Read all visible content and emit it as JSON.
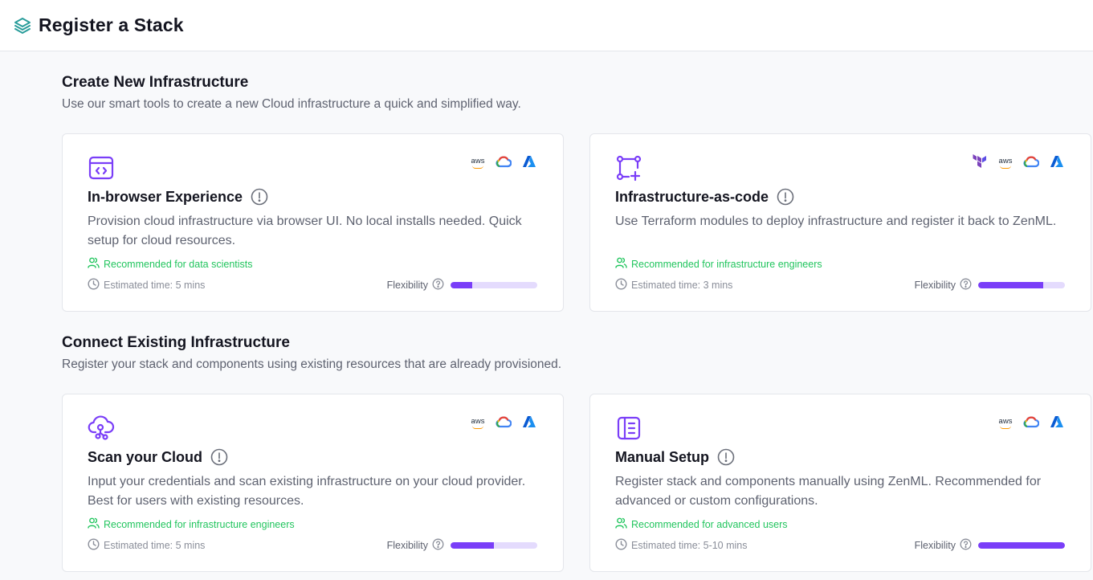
{
  "header": {
    "title": "Register a Stack",
    "icon": "stack-layers-icon"
  },
  "sections": [
    {
      "title": "Create New Infrastructure",
      "subtitle": "Use our smart tools to create a new Cloud infrastructure a quick and simplified way."
    },
    {
      "title": "Connect Existing Infrastructure",
      "subtitle": "Register your stack and components using existing resources that are already provisioned."
    }
  ],
  "cards": [
    {
      "title": "In-browser Experience",
      "icon": "browser-code-icon",
      "providers": [
        "aws",
        "gcp",
        "azure"
      ],
      "description": "Provision cloud infrastructure via browser UI. No local installs needed. Quick setup for cloud resources.",
      "recommended": "Recommended for data scientists",
      "estimated": "Estimated time: 5 mins",
      "flexibility_label": "Flexibility",
      "flexibility": 0.25
    },
    {
      "title": "Infrastructure-as-code",
      "icon": "nodes-plus-icon",
      "providers": [
        "terraform",
        "aws",
        "gcp",
        "azure"
      ],
      "description": "Use Terraform modules to deploy infrastructure and register it back to ZenML.",
      "recommended": "Recommended for infrastructure engineers",
      "estimated": "Estimated time: 3 mins",
      "flexibility_label": "Flexibility",
      "flexibility": 0.75
    },
    {
      "title": "Scan your Cloud",
      "icon": "cloud-scan-icon",
      "providers": [
        "aws",
        "gcp",
        "azure"
      ],
      "description": "Input your credentials and scan existing infrastructure on your cloud provider. Best for users with existing resources.",
      "recommended": "Recommended for infrastructure engineers",
      "estimated": "Estimated time: 5 mins",
      "flexibility_label": "Flexibility",
      "flexibility": 0.5
    },
    {
      "title": "Manual Setup",
      "icon": "manual-list-icon",
      "providers": [
        "aws",
        "gcp",
        "azure"
      ],
      "description": "Register stack and components manually using ZenML. Recommended for advanced or custom configurations.",
      "recommended": "Recommended for advanced users",
      "estimated": "Estimated time: 5-10 mins",
      "flexibility_label": "Flexibility",
      "flexibility": 1.0
    }
  ],
  "provider_labels": {
    "aws": "aws"
  },
  "colors": {
    "accent": "#7a3ef8",
    "accent_light": "#e4dbfd",
    "success": "#22c55e",
    "logo": "#2a9d9b"
  }
}
